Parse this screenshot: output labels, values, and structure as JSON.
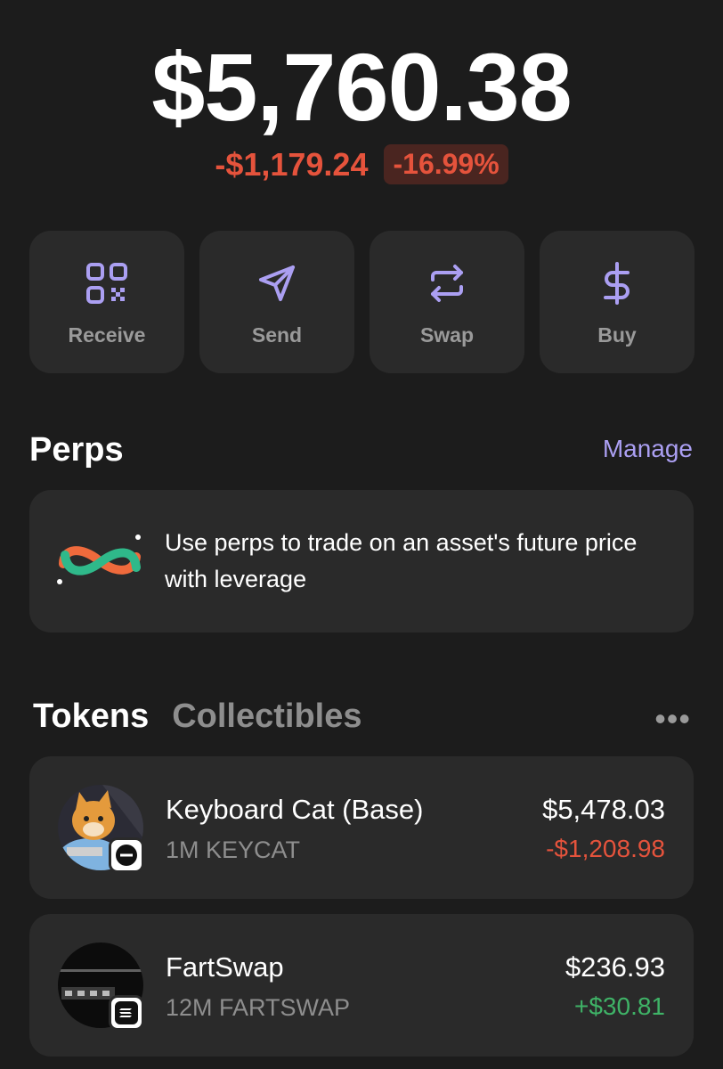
{
  "balance": {
    "total": "$5,760.38",
    "change_amount": "-$1,179.24",
    "change_percent": "-16.99%"
  },
  "actions": [
    {
      "label": "Receive",
      "icon": "qr-code-icon"
    },
    {
      "label": "Send",
      "icon": "send-arrow-icon"
    },
    {
      "label": "Swap",
      "icon": "swap-arrows-icon"
    },
    {
      "label": "Buy",
      "icon": "dollar-icon"
    }
  ],
  "perps": {
    "title": "Perps",
    "manage_label": "Manage",
    "description": "Use perps to trade on an asset's future price with leverage"
  },
  "tabs": {
    "tokens": "Tokens",
    "collectibles": "Collectibles",
    "more": "•••"
  },
  "tokens": [
    {
      "name": "Keyboard Cat (Base)",
      "amount": "1M KEYCAT",
      "value": "$5,478.03",
      "change": "-$1,208.98",
      "change_direction": "negative",
      "chain_icon": "base-chain-icon"
    },
    {
      "name": "FartSwap",
      "amount": "12M FARTSWAP",
      "value": "$236.93",
      "change": "+$30.81",
      "change_direction": "positive",
      "chain_icon": "solana-chain-icon"
    }
  ],
  "colors": {
    "background": "#1c1c1c",
    "card": "#2a2a2a",
    "accent": "#ab9ff2",
    "negative": "#e5533c",
    "positive": "#3fb367"
  }
}
